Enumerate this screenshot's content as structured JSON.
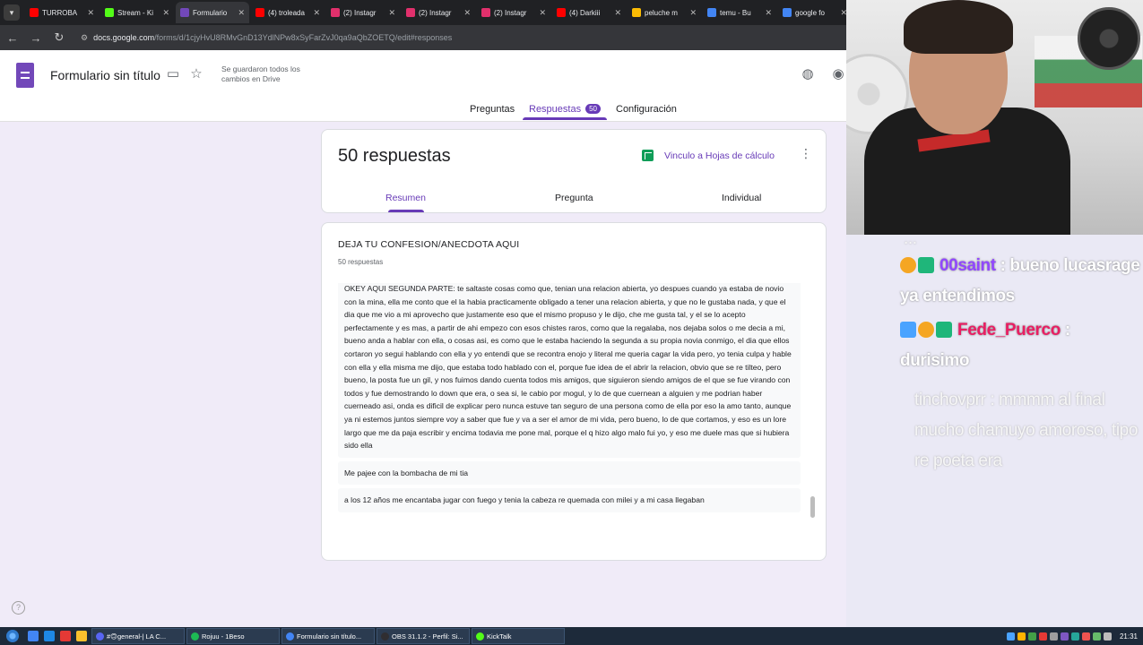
{
  "browser": {
    "tabs": [
      {
        "label": "TURROBA",
        "color": "#ff0000",
        "active": false
      },
      {
        "label": "Stream - Ki",
        "color": "#53fc18",
        "active": false
      },
      {
        "label": "Formulario",
        "color": "#7248b9",
        "active": true
      },
      {
        "label": "(4) troleada",
        "color": "#ff0000",
        "active": false
      },
      {
        "label": "(2) Instagr",
        "color": "#e1306c",
        "active": false
      },
      {
        "label": "(2) Instagr",
        "color": "#e1306c",
        "active": false
      },
      {
        "label": "(2) Instagr",
        "color": "#e1306c",
        "active": false
      },
      {
        "label": "(4) Darkiii",
        "color": "#ff0000",
        "active": false
      },
      {
        "label": "peluche m",
        "color": "#fbbc04",
        "active": false
      },
      {
        "label": "temu - Bu",
        "color": "#4285f4",
        "active": false
      },
      {
        "label": "google fo",
        "color": "#4285f4",
        "active": false
      }
    ],
    "url_host": "docs.google.com",
    "url_path": "/forms/d/1cjyHvU8RMvGnD13YdlNPw8xSyFarZvJ0qa9aQbZOETQ/edit#responses"
  },
  "forms": {
    "doc_title": "Formulario sin título",
    "save_status": "Se guardaron todos los cambios en Drive",
    "nav_tabs": {
      "questions": "Preguntas",
      "responses": "Respuestas",
      "responses_count": "50",
      "settings": "Configuración"
    },
    "summary": {
      "count_title": "50 respuestas",
      "sheets_link": "Vinculo a Hojas de cálculo",
      "tabs": {
        "summary": "Resumen",
        "question": "Pregunta",
        "individual": "Individual"
      }
    },
    "question": {
      "title": "DEJA TU CONFESION/ANECDOTA AQUI",
      "response_count": "50 respuestas",
      "answers": [
        "OKEY AQUI SEGUNDA PARTE: te saltaste cosas como que, tenian una relacion abierta, yo despues cuando ya estaba de novio con la mina, ella me conto que el la habia practicamente obligado a tener una relacion abierta, y que no le gustaba nada, y que el dia que me vio a mi aprovecho que justamente eso que el mismo propuso y le dijo, che me gusta tal, y el se lo acepto perfectamente y es mas, a partir de ahi empezo con esos chistes raros, como que la regalaba, nos dejaba solos o me decia a mi, bueno anda a hablar con ella, o cosas asi, es como que le estaba haciendo la segunda a su propia novia conmigo, el dia que ellos cortaron yo segui hablando con ella y yo entendi que se recontra enojo y literal me queria cagar la vida pero, yo tenia culpa y hable con ella y ella misma me dijo, que estaba todo hablado con el, porque fue idea de el abrir la relacion, obvio que se re tilteo, pero bueno, la posta fue un gil, y nos fuimos dando cuenta todos mis amigos, que siguieron siendo amigos de el que se fue virando con todos y fue demostrando lo down que era, o sea si, le cabio por mogul, y lo de que cuernean a alguien y me podrian haber cuerneado asi, onda es dificil de explicar pero nunca estuve tan seguro de una persona como de ella por eso la amo tanto, aunque ya ni estemos juntos siempre voy a saber que fue y va a ser el amor de mi vida, pero bueno, lo de que cortamos, y eso es un lore largo que me da paja escribir y encima todavia me pone mal, porque el q hizo algo malo fui yo, y eso me duele mas que si hubiera sido ella",
        "Me pajee con la bombacha de mi tia",
        "a los 12 años me encantaba jugar con fuego y tenia la cabeza re quemada con milei y a mi casa llegaban"
      ]
    },
    "help_icon": "help-icon"
  },
  "chat": {
    "messages": [
      {
        "user": "",
        "text": "...",
        "style": "cut"
      },
      {
        "user": "00saint",
        "text": ": bueno lucasrage ya entendimos",
        "style": "normal"
      },
      {
        "user": "Fede_Puerco",
        "text": ": durisimo",
        "style": "red"
      },
      {
        "user": "tinchovprr",
        "text": ": mmmm al final mucho chamuyo amoroso, tipo re poeta era",
        "style": "faded"
      }
    ]
  },
  "taskbar": {
    "tasks": [
      {
        "label": "#🙃general-| LA C...",
        "color": "#5865f2"
      },
      {
        "label": "Rojuu - 1Beso",
        "color": "#1db954"
      },
      {
        "label": "Formulario sin título...",
        "color": "#4285f4"
      },
      {
        "label": "OBS 31.1.2 - Perfil: Si...",
        "color": "#302e31"
      },
      {
        "label": "KickTalk",
        "color": "#53fc18"
      }
    ],
    "clock": "21:31"
  },
  "colors": {
    "forms_accent": "#673ab7",
    "forms_background": "#f0ebf8",
    "sheets_green": "#0f9d58"
  }
}
